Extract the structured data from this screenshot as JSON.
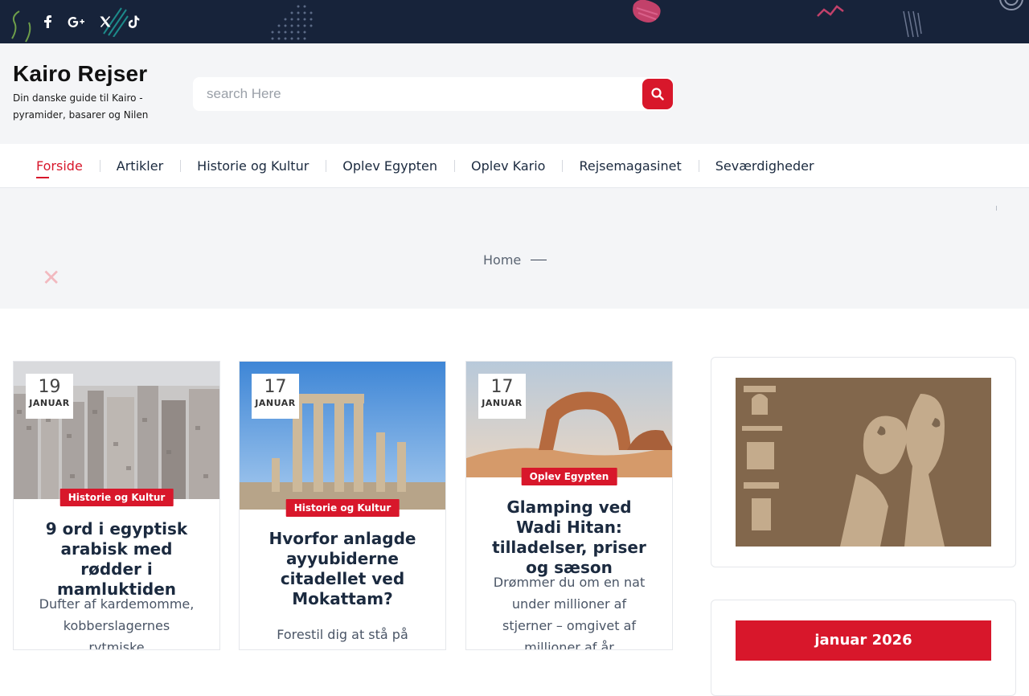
{
  "topbar": {
    "social": [
      {
        "name": "facebook"
      },
      {
        "name": "google-plus"
      },
      {
        "name": "x-twitter"
      },
      {
        "name": "tiktok"
      }
    ],
    "bg_color": "#17233a"
  },
  "header": {
    "title": "Kairo Rejser",
    "description": "Din danske guide til Kairo - pyramider, basarer og Nilen"
  },
  "search": {
    "placeholder": "search Here",
    "value": ""
  },
  "nav": {
    "items": [
      {
        "label": "Forside",
        "active": true
      },
      {
        "label": "Artikler"
      },
      {
        "label": "Historie og Kultur"
      },
      {
        "label": "Oplev Egypten"
      },
      {
        "label": "Oplev Kario"
      },
      {
        "label": "Rejsemagasinet"
      },
      {
        "label": "Seværdigheder"
      }
    ]
  },
  "breadcrumb": {
    "home": "Home"
  },
  "posts": [
    {
      "day": "19",
      "month": "JANUAR",
      "category": "Historie og Kultur",
      "title": "9 ord i egyptisk arabisk med rødder i mamluktiden",
      "excerpt": "Dufter af kardemomme, kobberslagernes rytmiske"
    },
    {
      "day": "17",
      "month": "JANUAR",
      "category": "Historie og Kultur",
      "title": "Hvorfor anlagde ayyubiderne citadellet ved Mokattam?",
      "excerpt": "Forestil dig at stå på toppen"
    },
    {
      "day": "17",
      "month": "JANUAR",
      "category": "Oplev Egypten",
      "title": "Glamping ved Wadi Hitan: tilladelser, priser og sæson",
      "excerpt": "Drømmer du om en nat under millioner af stjerner – omgivet af millioner af år"
    }
  ],
  "sidebar": {
    "calendar_month": "januar 2026"
  },
  "colors": {
    "accent": "#d8172b",
    "navy": "#17233a",
    "header_bg": "#f4f5f7"
  }
}
